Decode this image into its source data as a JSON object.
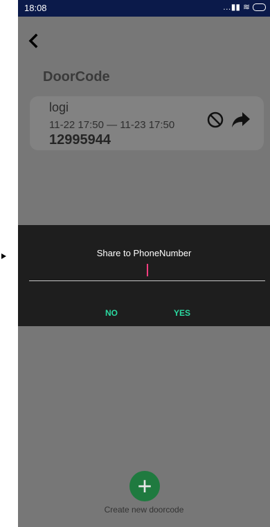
{
  "status_bar": {
    "time": "18:08",
    "icons": [
      "signal-icon",
      "wifi-icon",
      "battery-icon"
    ]
  },
  "header": {
    "title": "DoorCode"
  },
  "card": {
    "name": "logi",
    "time_range": "11-22 17:50 — 11-23 17:50",
    "code": "12995944"
  },
  "dialog": {
    "title": "Share to PhoneNumber",
    "input_value": "",
    "no_label": "NO",
    "yes_label": "YES"
  },
  "create": {
    "label": "Create new doorcode"
  },
  "colors": {
    "status_bar": "#0b1a4a",
    "accent": "#2bd9a0",
    "fab": "#1f7a3f",
    "dim_background": "#777777"
  }
}
